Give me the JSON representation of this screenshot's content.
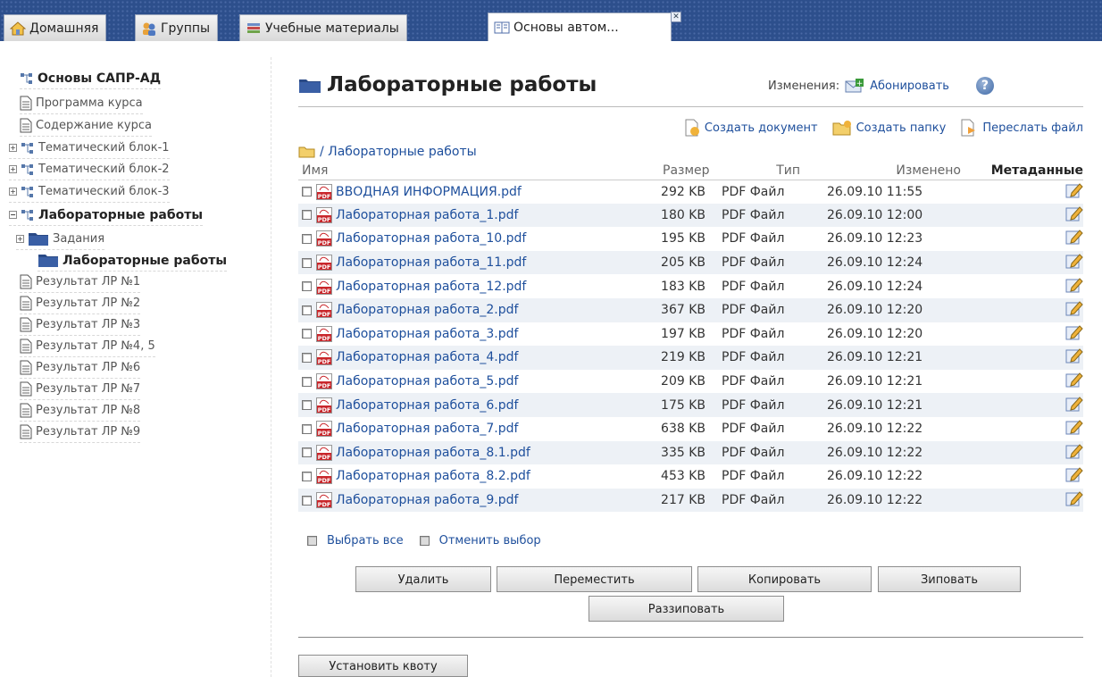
{
  "tabs": [
    {
      "label": "Домашняя",
      "icon": "home-icon"
    },
    {
      "label": "Группы",
      "icon": "groups-icon"
    },
    {
      "label": "Учебные материалы",
      "icon": "books-icon"
    },
    {
      "label": "Основы автом...",
      "icon": "book-open-icon",
      "active": true
    }
  ],
  "tree": {
    "items": [
      {
        "label": "Основы САПР-АД",
        "kind": "root",
        "bold": true
      },
      {
        "label": "Программа курса",
        "kind": "doc"
      },
      {
        "label": "Содержание курса",
        "kind": "doc"
      },
      {
        "label": "Тематический блок-1",
        "kind": "node"
      },
      {
        "label": "Тематический блок-2",
        "kind": "node"
      },
      {
        "label": "Тематический блок-3",
        "kind": "node"
      },
      {
        "label": "Лабораторные работы",
        "kind": "node-open",
        "bold": true
      },
      {
        "label": "Задания",
        "kind": "folder-plus"
      },
      {
        "label": "Лабораторные работы",
        "kind": "folder",
        "bold": true
      },
      {
        "label": "Результат ЛР №1",
        "kind": "doc"
      },
      {
        "label": "Результат ЛР №2",
        "kind": "doc"
      },
      {
        "label": "Результат ЛР №3",
        "kind": "doc"
      },
      {
        "label": "Результат ЛР №4, 5",
        "kind": "doc"
      },
      {
        "label": "Результат ЛР №6",
        "kind": "doc"
      },
      {
        "label": "Результат ЛР №7",
        "kind": "doc"
      },
      {
        "label": "Результат ЛР №8",
        "kind": "doc"
      },
      {
        "label": "Результат ЛР №9",
        "kind": "doc"
      }
    ]
  },
  "main": {
    "title": "Лабораторные работы",
    "changes_label": "Изменения:",
    "subscribe_label": "Абонировать",
    "help_label": "?",
    "actions": {
      "create_document": "Создать документ",
      "create_folder": "Создать папку",
      "send_file": "Переслать файл"
    },
    "breadcrumb": "/ Лабораторные работы",
    "columns": {
      "name": "Имя",
      "size": "Размер",
      "type": "Тип",
      "modified": "Изменено",
      "metadata": "Метаданные"
    },
    "files": [
      {
        "name": "ВВОДНАЯ ИНФОРМАЦИЯ.pdf",
        "size": "292 KB",
        "type": "PDF Файл",
        "modified": "26.09.10 11:55"
      },
      {
        "name": "Лабораторная работа_1.pdf",
        "size": "180 KB",
        "type": "PDF Файл",
        "modified": "26.09.10 12:00"
      },
      {
        "name": "Лабораторная работа_10.pdf",
        "size": "195 KB",
        "type": "PDF Файл",
        "modified": "26.09.10 12:23"
      },
      {
        "name": "Лабораторная работа_11.pdf",
        "size": "205 KB",
        "type": "PDF Файл",
        "modified": "26.09.10 12:24"
      },
      {
        "name": "Лабораторная работа_12.pdf",
        "size": "183 KB",
        "type": "PDF Файл",
        "modified": "26.09.10 12:24"
      },
      {
        "name": "Лабораторная работа_2.pdf",
        "size": "367 KB",
        "type": "PDF Файл",
        "modified": "26.09.10 12:20"
      },
      {
        "name": "Лабораторная работа_3.pdf",
        "size": "197 KB",
        "type": "PDF Файл",
        "modified": "26.09.10 12:20"
      },
      {
        "name": "Лабораторная работа_4.pdf",
        "size": "219 KB",
        "type": "PDF Файл",
        "modified": "26.09.10 12:21"
      },
      {
        "name": "Лабораторная работа_5.pdf",
        "size": "209 KB",
        "type": "PDF Файл",
        "modified": "26.09.10 12:21"
      },
      {
        "name": "Лабораторная работа_6.pdf",
        "size": "175 KB",
        "type": "PDF Файл",
        "modified": "26.09.10 12:21"
      },
      {
        "name": "Лабораторная работа_7.pdf",
        "size": "638 KB",
        "type": "PDF Файл",
        "modified": "26.09.10 12:22"
      },
      {
        "name": "Лабораторная работа_8.1.pdf",
        "size": "335 KB",
        "type": "PDF Файл",
        "modified": "26.09.10 12:22"
      },
      {
        "name": "Лабораторная работа_8.2.pdf",
        "size": "453 KB",
        "type": "PDF Файл",
        "modified": "26.09.10 12:22"
      },
      {
        "name": "Лабораторная работа_9.pdf",
        "size": "217 KB",
        "type": "PDF Файл",
        "modified": "26.09.10 12:22"
      }
    ],
    "select_all": "Выбрать все",
    "deselect": "Отменить выбор",
    "buttons": {
      "delete": "Удалить",
      "move": "Переместить",
      "copy": "Копировать",
      "zip": "Зиповать",
      "unzip": "Раззиповать",
      "quota": "Установить квоту"
    }
  },
  "colors": {
    "tabbar_bg": "#2d4f8c",
    "link": "#1e4f9c",
    "row_alt": "#edf1f6"
  }
}
